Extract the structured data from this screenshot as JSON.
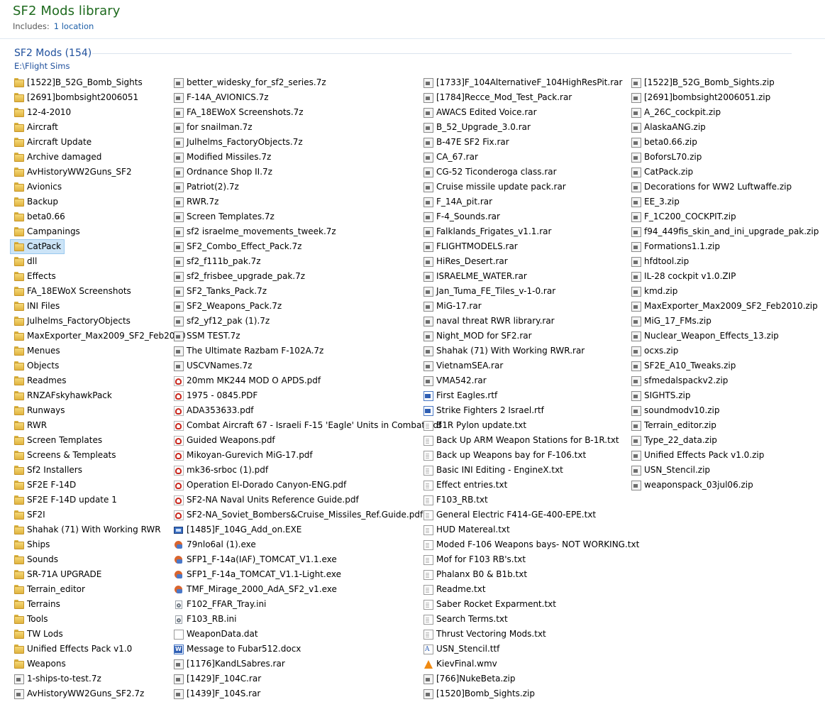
{
  "library": {
    "title": "SF2 Mods library",
    "includes_label": "Includes:",
    "includes_link": "1 location"
  },
  "group": {
    "title": "SF2 Mods (154)",
    "path": "E:\\Flight Sims"
  },
  "columns": [
    [
      {
        "name": "[1522]B_52G_Bomb_Sights",
        "icon": "folder-icon"
      },
      {
        "name": "[2691]bombsight2006051",
        "icon": "folder-icon"
      },
      {
        "name": "12-4-2010",
        "icon": "folder-icon"
      },
      {
        "name": "Aircraft",
        "icon": "folder-icon"
      },
      {
        "name": "Aircraft Update",
        "icon": "folder-icon"
      },
      {
        "name": "Archive damaged",
        "icon": "folder-icon"
      },
      {
        "name": "AvHistoryWW2Guns_SF2",
        "icon": "folder-icon"
      },
      {
        "name": "Avionics",
        "icon": "folder-icon"
      },
      {
        "name": "Backup",
        "icon": "folder-icon"
      },
      {
        "name": "beta0.66",
        "icon": "folder-icon"
      },
      {
        "name": "Campanings",
        "icon": "folder-icon"
      },
      {
        "name": "CatPack",
        "icon": "folder-icon",
        "selected": true
      },
      {
        "name": "dll",
        "icon": "folder-icon"
      },
      {
        "name": "Effects",
        "icon": "folder-icon"
      },
      {
        "name": "FA_18EWoX Screenshots",
        "icon": "folder-icon"
      },
      {
        "name": "INI Files",
        "icon": "folder-icon"
      },
      {
        "name": "Julhelms_FactoryObjects",
        "icon": "folder-icon"
      },
      {
        "name": "MaxExporter_Max2009_SF2_Feb2010",
        "icon": "folder-icon"
      },
      {
        "name": "Menues",
        "icon": "folder-icon"
      },
      {
        "name": "Objects",
        "icon": "folder-icon"
      },
      {
        "name": "Readmes",
        "icon": "folder-icon"
      },
      {
        "name": "RNZAFskyhawkPack",
        "icon": "folder-icon"
      },
      {
        "name": "Runways",
        "icon": "folder-icon"
      },
      {
        "name": "RWR",
        "icon": "folder-icon"
      },
      {
        "name": "Screen Templates",
        "icon": "folder-icon"
      },
      {
        "name": "Screens & Templeats",
        "icon": "folder-icon"
      },
      {
        "name": "Sf2 Installers",
        "icon": "folder-icon"
      },
      {
        "name": "SF2E F-14D",
        "icon": "folder-icon"
      },
      {
        "name": "SF2E F-14D update 1",
        "icon": "folder-icon"
      },
      {
        "name": "SF2I",
        "icon": "folder-icon"
      },
      {
        "name": "Shahak (71) With Working RWR",
        "icon": "folder-icon"
      },
      {
        "name": "Ships",
        "icon": "folder-icon"
      },
      {
        "name": "Sounds",
        "icon": "folder-icon"
      },
      {
        "name": "SR-71A UPGRADE",
        "icon": "folder-icon"
      },
      {
        "name": "Terrain_editor",
        "icon": "folder-icon"
      },
      {
        "name": "Terrains",
        "icon": "folder-icon"
      },
      {
        "name": "Tools",
        "icon": "folder-icon"
      },
      {
        "name": "TW Lods",
        "icon": "folder-icon"
      },
      {
        "name": "Unified Effects Pack v1.0",
        "icon": "folder-icon"
      },
      {
        "name": "Weapons",
        "icon": "folder-icon"
      },
      {
        "name": "1-ships-to-test.7z",
        "icon": "archive-icon"
      },
      {
        "name": "AvHistoryWW2Guns_SF2.7z",
        "icon": "archive-icon"
      }
    ],
    [
      {
        "name": "better_widesky_for_sf2_series.7z",
        "icon": "archive-icon"
      },
      {
        "name": "F-14A_AVIONICS.7z",
        "icon": "archive-icon"
      },
      {
        "name": "FA_18EWoX Screenshots.7z",
        "icon": "archive-icon"
      },
      {
        "name": "for snailman.7z",
        "icon": "archive-icon"
      },
      {
        "name": "Julhelms_FactoryObjects.7z",
        "icon": "archive-icon"
      },
      {
        "name": "Modified Missiles.7z",
        "icon": "archive-icon"
      },
      {
        "name": "Ordnance Shop II.7z",
        "icon": "archive-icon"
      },
      {
        "name": "Patriot(2).7z",
        "icon": "archive-icon"
      },
      {
        "name": "RWR.7z",
        "icon": "archive-icon"
      },
      {
        "name": "Screen Templates.7z",
        "icon": "archive-icon"
      },
      {
        "name": "sf2 israelme_movements_tweek.7z",
        "icon": "archive-icon"
      },
      {
        "name": "SF2_Combo_Effect_Pack.7z",
        "icon": "archive-icon"
      },
      {
        "name": "sf2_f111b_pak.7z",
        "icon": "archive-icon"
      },
      {
        "name": "sf2_frisbee_upgrade_pak.7z",
        "icon": "archive-icon"
      },
      {
        "name": "SF2_Tanks_Pack.7z",
        "icon": "archive-icon"
      },
      {
        "name": "SF2_Weapons_Pack.7z",
        "icon": "archive-icon"
      },
      {
        "name": "sf2_yf12_pak (1).7z",
        "icon": "archive-icon"
      },
      {
        "name": "SSM TEST.7z",
        "icon": "archive-icon"
      },
      {
        "name": "The Ultimate Razbam F-102A.7z",
        "icon": "archive-icon"
      },
      {
        "name": "USCVNames.7z",
        "icon": "archive-icon"
      },
      {
        "name": "20mm MK244 MOD O APDS.pdf",
        "icon": "pdf-icon"
      },
      {
        "name": "1975 - 0845.PDF",
        "icon": "pdf-icon"
      },
      {
        "name": "ADA353633.pdf",
        "icon": "pdf-icon"
      },
      {
        "name": "Combat Aircraft 67 - Israeli F-15 'Eagle' Units in Combat.pdf",
        "icon": "pdf-icon"
      },
      {
        "name": "Guided Weapons.pdf",
        "icon": "pdf-icon"
      },
      {
        "name": "Mikoyan-Gurevich MiG-17.pdf",
        "icon": "pdf-icon"
      },
      {
        "name": "mk36-srboc (1).pdf",
        "icon": "pdf-icon"
      },
      {
        "name": "Operation El-Dorado Canyon-ENG.pdf",
        "icon": "pdf-icon"
      },
      {
        "name": "SF2-NA Naval Units Reference Guide.pdf",
        "icon": "pdf-icon"
      },
      {
        "name": "SF2-NA_Soviet_Bombers&Cruise_Missiles_Ref.Guide.pdf",
        "icon": "pdf-icon"
      },
      {
        "name": "[1485]F_104G_Add_on.EXE",
        "icon": "exe2-icon"
      },
      {
        "name": "79nlo6al (1).exe",
        "icon": "exe-icon"
      },
      {
        "name": "SFP1_F-14a(IAF)_TOMCAT_V1.1.exe",
        "icon": "exe-icon"
      },
      {
        "name": "SFP1_F-14a_TOMCAT_V1.1-Light.exe",
        "icon": "exe-icon"
      },
      {
        "name": "TMF_Mirage_2000_AdA_SF2_v1.exe",
        "icon": "exe-icon"
      },
      {
        "name": "F102_FFAR_Tray.ini",
        "icon": "ini-icon"
      },
      {
        "name": "F103_RB.ini",
        "icon": "ini-icon"
      },
      {
        "name": "WeaponData.dat",
        "icon": "dat-icon"
      },
      {
        "name": "Message to Fubar512.docx",
        "icon": "docx-icon"
      },
      {
        "name": "[1176]KandLSabres.rar",
        "icon": "archive-icon"
      },
      {
        "name": "[1429]F_104C.rar",
        "icon": "archive-icon"
      },
      {
        "name": "[1439]F_104S.rar",
        "icon": "archive-icon"
      }
    ],
    [
      {
        "name": "[1733]F_104AlternativeF_104HighResPit.rar",
        "icon": "archive-icon"
      },
      {
        "name": "[1784]Recce_Mod_Test_Pack.rar",
        "icon": "archive-icon"
      },
      {
        "name": "AWACS Edited Voice.rar",
        "icon": "archive-icon"
      },
      {
        "name": "B_52_Upgrade_3.0.rar",
        "icon": "archive-icon"
      },
      {
        "name": "B-47E SF2 Fix.rar",
        "icon": "archive-icon"
      },
      {
        "name": "CA_67.rar",
        "icon": "archive-icon"
      },
      {
        "name": "CG-52 Ticonderoga class.rar",
        "icon": "archive-icon"
      },
      {
        "name": "Cruise missile update pack.rar",
        "icon": "archive-icon"
      },
      {
        "name": "F_14A_pit.rar",
        "icon": "archive-icon"
      },
      {
        "name": "F-4_Sounds.rar",
        "icon": "archive-icon"
      },
      {
        "name": "Falklands_Frigates_v1.1.rar",
        "icon": "archive-icon"
      },
      {
        "name": "FLIGHTMODELS.rar",
        "icon": "archive-icon"
      },
      {
        "name": "HiRes_Desert.rar",
        "icon": "archive-icon"
      },
      {
        "name": "ISRAELME_WATER.rar",
        "icon": "archive-icon"
      },
      {
        "name": "Jan_Tuma_FE_Tiles_v-1-0.rar",
        "icon": "archive-icon"
      },
      {
        "name": "MiG-17.rar",
        "icon": "archive-icon"
      },
      {
        "name": "naval threat RWR library.rar",
        "icon": "archive-icon"
      },
      {
        "name": "Night_MOD for SF2.rar",
        "icon": "archive-icon"
      },
      {
        "name": "Shahak (71) With Working RWR.rar",
        "icon": "archive-icon"
      },
      {
        "name": "VietnamSEA.rar",
        "icon": "archive-icon"
      },
      {
        "name": "VMA542.rar",
        "icon": "archive-icon"
      },
      {
        "name": "First Eagles.rtf",
        "icon": "rtf-icon"
      },
      {
        "name": "Strike Fighters 2 Israel.rtf",
        "icon": "rtf-icon"
      },
      {
        "name": "B1R Pylon update.txt",
        "icon": "txt-icon"
      },
      {
        "name": "Back Up ARM Weapon Stations for B-1R.txt",
        "icon": "txt-icon"
      },
      {
        "name": "Back up Weapons bay for F-106.txt",
        "icon": "txt-icon"
      },
      {
        "name": "Basic INI Editing - EngineX.txt",
        "icon": "txt-icon"
      },
      {
        "name": "Effect entries.txt",
        "icon": "txt-icon"
      },
      {
        "name": "F103_RB.txt",
        "icon": "txt-icon"
      },
      {
        "name": "General Electric F414-GE-400-EPE.txt",
        "icon": "txt-icon"
      },
      {
        "name": "HUD Matereal.txt",
        "icon": "txt-icon"
      },
      {
        "name": "Moded F-106 Weapons bays- NOT WORKING.txt",
        "icon": "txt-icon"
      },
      {
        "name": "Mof for F103 RB's.txt",
        "icon": "txt-icon"
      },
      {
        "name": "Phalanx B0 & B1b.txt",
        "icon": "txt-icon"
      },
      {
        "name": "Readme.txt",
        "icon": "txt-icon"
      },
      {
        "name": "Saber Rocket Exparment.txt",
        "icon": "txt-icon"
      },
      {
        "name": "Search Terms.txt",
        "icon": "txt-icon"
      },
      {
        "name": "Thrust Vectoring Mods.txt",
        "icon": "txt-icon"
      },
      {
        "name": "USN_Stencil.ttf",
        "icon": "ttf-icon"
      },
      {
        "name": "KievFinal.wmv",
        "icon": "wmv-icon"
      },
      {
        "name": "[766]NukeBeta.zip",
        "icon": "archive-icon"
      },
      {
        "name": "[1520]Bomb_Sights.zip",
        "icon": "archive-icon"
      }
    ],
    [
      {
        "name": "[1522]B_52G_Bomb_Sights.zip",
        "icon": "archive-icon"
      },
      {
        "name": "[2691]bombsight2006051.zip",
        "icon": "archive-icon"
      },
      {
        "name": "A_26C_cockpit.zip",
        "icon": "archive-icon"
      },
      {
        "name": "AlaskaANG.zip",
        "icon": "archive-icon"
      },
      {
        "name": "beta0.66.zip",
        "icon": "archive-icon"
      },
      {
        "name": "BoforsL70.zip",
        "icon": "archive-icon"
      },
      {
        "name": "CatPack.zip",
        "icon": "archive-icon"
      },
      {
        "name": "Decorations for WW2 Luftwaffe.zip",
        "icon": "archive-icon"
      },
      {
        "name": "EE_3.zip",
        "icon": "archive-icon"
      },
      {
        "name": "F_1C200_COCKPIT.zip",
        "icon": "archive-icon"
      },
      {
        "name": "f94_449fis_skin_and_ini_upgrade_pak.zip",
        "icon": "archive-icon"
      },
      {
        "name": "Formations1.1.zip",
        "icon": "archive-icon"
      },
      {
        "name": "hfdtool.zip",
        "icon": "archive-icon"
      },
      {
        "name": "IL-28 cockpit v1.0.ZIP",
        "icon": "archive-icon"
      },
      {
        "name": "kmd.zip",
        "icon": "archive-icon"
      },
      {
        "name": "MaxExporter_Max2009_SF2_Feb2010.zip",
        "icon": "archive-icon"
      },
      {
        "name": "MiG_17_FMs.zip",
        "icon": "archive-icon"
      },
      {
        "name": "Nuclear_Weapon_Effects_13.zip",
        "icon": "archive-icon"
      },
      {
        "name": "ocxs.zip",
        "icon": "archive-icon"
      },
      {
        "name": "SF2E_A10_Tweaks.zip",
        "icon": "archive-icon"
      },
      {
        "name": "sfmedalspackv2.zip",
        "icon": "archive-icon"
      },
      {
        "name": "SIGHTS.zip",
        "icon": "archive-icon"
      },
      {
        "name": "soundmodv10.zip",
        "icon": "archive-icon"
      },
      {
        "name": "Terrain_editor.zip",
        "icon": "archive-icon"
      },
      {
        "name": "Type_22_data.zip",
        "icon": "archive-icon"
      },
      {
        "name": "Unified Effects Pack v1.0.zip",
        "icon": "archive-icon"
      },
      {
        "name": "USN_Stencil.zip",
        "icon": "archive-icon"
      },
      {
        "name": "weaponspack_03jul06.zip",
        "icon": "archive-icon"
      }
    ]
  ]
}
